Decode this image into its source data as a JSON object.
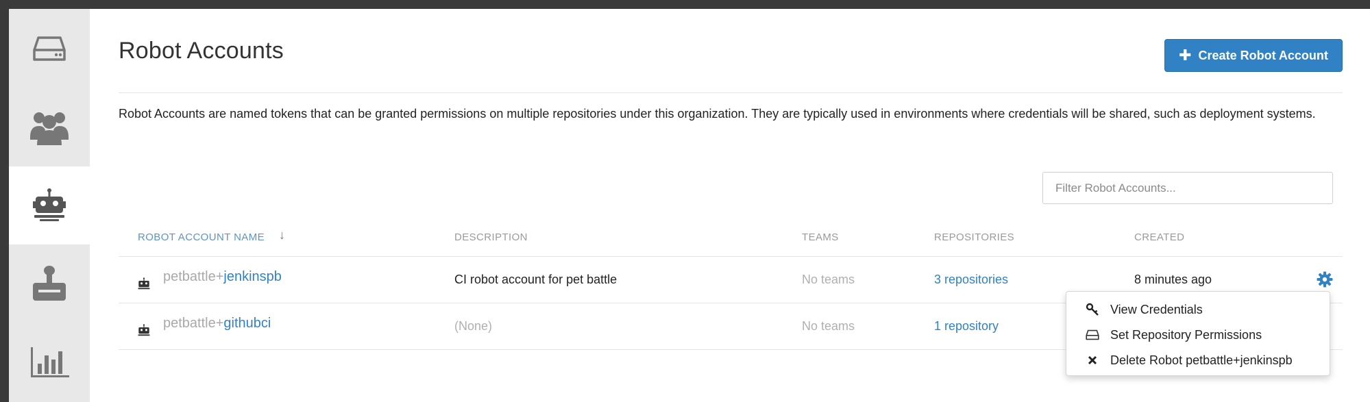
{
  "page": {
    "title": "Robot Accounts",
    "create_button_label": "Create Robot Account",
    "description": "Robot Accounts are named tokens that can be granted permissions on multiple repositories under this organization. They are typically used in environments where credentials will be shared, such as deployment systems."
  },
  "filter": {
    "placeholder": "Filter Robot Accounts..."
  },
  "sidebar": {
    "items": [
      {
        "icon": "hard-drive-icon"
      },
      {
        "icon": "users-icon"
      },
      {
        "icon": "robot-icon",
        "active": true
      },
      {
        "icon": "joystick-icon"
      },
      {
        "icon": "bar-chart-icon"
      }
    ]
  },
  "table": {
    "columns": [
      "ROBOT ACCOUNT NAME",
      "DESCRIPTION",
      "TEAMS",
      "REPOSITORIES",
      "CREATED"
    ],
    "sort_arrow": "↓",
    "rows": [
      {
        "name_prefix": "petbattle+",
        "name_suffix": "jenkinspb",
        "description": "CI robot account for pet battle",
        "teams": "No teams",
        "repositories": "3 repositories",
        "created": "8 minutes ago"
      },
      {
        "name_prefix": "petbattle+",
        "name_suffix": "githubci",
        "description": "(None)",
        "teams": "No teams",
        "repositories": "1 repository",
        "created": ""
      }
    ]
  },
  "dropdown": {
    "items": [
      {
        "label": "View Credentials",
        "icon": "key-icon"
      },
      {
        "label": "Set Repository Permissions",
        "icon": "hard-drive-icon"
      },
      {
        "label": "Delete Robot petbattle+jenkinspb",
        "icon": "close-icon"
      }
    ]
  },
  "colors": {
    "accent": "#3182c4",
    "sidebar_bg": "#e8e8e8",
    "muted_text": "#b0b0b0"
  }
}
